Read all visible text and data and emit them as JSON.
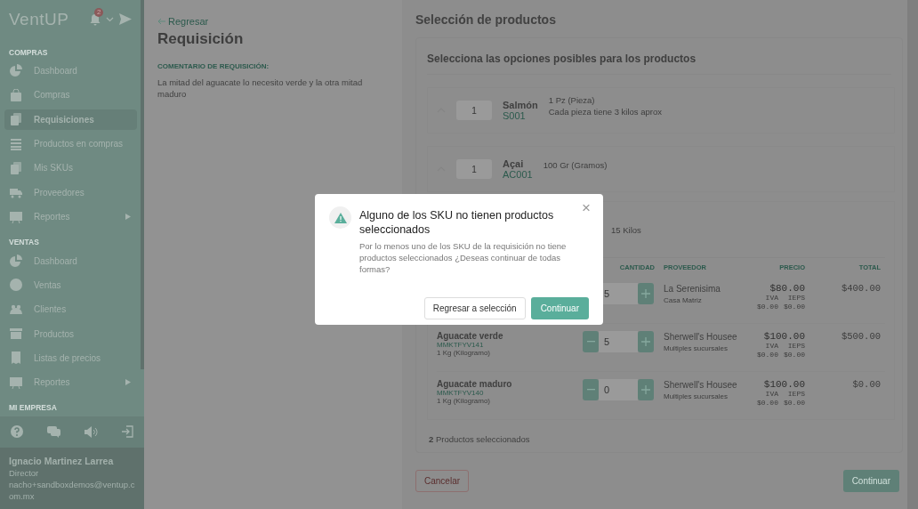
{
  "sidebar": {
    "logo": "VentUP",
    "notification_count": "2",
    "sections": [
      {
        "title": "COMPRAS",
        "items": [
          {
            "label": "Dashboard",
            "selected": false,
            "submenu": false
          },
          {
            "label": "Compras",
            "selected": false,
            "submenu": false
          },
          {
            "label": "Requisiciones",
            "selected": true,
            "submenu": false
          },
          {
            "label": "Productos en compras",
            "selected": false,
            "submenu": false
          },
          {
            "label": "Mis SKUs",
            "selected": false,
            "submenu": false
          },
          {
            "label": "Proveedores",
            "selected": false,
            "submenu": false
          },
          {
            "label": "Reportes",
            "selected": false,
            "submenu": true
          }
        ]
      },
      {
        "title": "VENTAS",
        "items": [
          {
            "label": "Dashboard",
            "selected": false,
            "submenu": false
          },
          {
            "label": "Ventas",
            "selected": false,
            "submenu": false
          },
          {
            "label": "Clientes",
            "selected": false,
            "submenu": false
          },
          {
            "label": "Productos",
            "selected": false,
            "submenu": false
          },
          {
            "label": "Listas de precios",
            "selected": false,
            "submenu": false
          },
          {
            "label": "Reportes",
            "selected": false,
            "submenu": true
          }
        ]
      },
      {
        "title": "MI EMPRESA"
      }
    ],
    "user": {
      "name": "Ignacio Martinez Larrea",
      "role": "Director",
      "email": "nacho+sandboxdemos@ventup.com.mx"
    }
  },
  "requisition": {
    "back_link": "Regresar",
    "title": "Requisición",
    "comment_label": "COMENTARIO DE REQUISICIÓN:",
    "comment": "La mitad del aguacate lo necesito verde y la otra mitad maduro"
  },
  "selection": {
    "title": "Selección de productos",
    "subtitle": "Selecciona las opciones posibles para los productos",
    "skus": [
      {
        "name": "Salmón",
        "code": "S001",
        "quantity": "1",
        "unit": "1 Pz (Pieza)",
        "note": "Cada pieza tiene 3 kilos aprox"
      },
      {
        "name": "Açai",
        "code": "AC001",
        "quantity": "1",
        "unit": "100 Gr (Gramos)"
      }
    ],
    "open_sku": {
      "note": "15 Kilos",
      "columns": [
        "CANTIDAD",
        "PROVEEDOR",
        "PRECIO",
        "TOTAL"
      ],
      "products": [
        {
          "quantity": "5",
          "provider": "La Serenisima",
          "branch": "Casa Matriz",
          "price": "$80.00",
          "tax_1_label": "IVA",
          "tax_1": "$0.00",
          "tax_2_label": "IEPS",
          "tax_2": "$0.00",
          "total": "$400.00"
        },
        {
          "name": "Aguacate verde",
          "code": "MMKTFYV141",
          "unit": "1 Kg (Kilogramo)",
          "quantity": "5",
          "provider": "Sherwell's Housee",
          "branch": "Multiples sucursales",
          "price": "$100.00",
          "tax_1_label": "IVA",
          "tax_1": "$0.00",
          "tax_2_label": "IEPS",
          "tax_2": "$0.00",
          "total": "$500.00"
        },
        {
          "name": "Aguacate maduro",
          "code": "MMKTFYV140",
          "unit": "1 Kg (Kilogramo)",
          "quantity": "0",
          "provider": "Sherwell's Housee",
          "branch": "Multiples sucursales",
          "price": "$100.00",
          "tax_1_label": "IVA",
          "tax_1": "$0.00",
          "tax_2_label": "IEPS",
          "tax_2": "$0.00",
          "total": "$0.00"
        }
      ]
    },
    "summary": "**2** Productos seleccionados",
    "cancel_button": "Cancelar",
    "continue_button": "Continuar"
  },
  "dialog": {
    "title": "Alguno de los SKU no tienen productos seleccionados",
    "message": "Por lo menos uno de los SKU de la requisición no tiene productos seleccionados ¿Deseas continuar de todas formas?",
    "close": "×",
    "secondary_button": "Regresar a selección",
    "primary_button": "Continuar"
  }
}
